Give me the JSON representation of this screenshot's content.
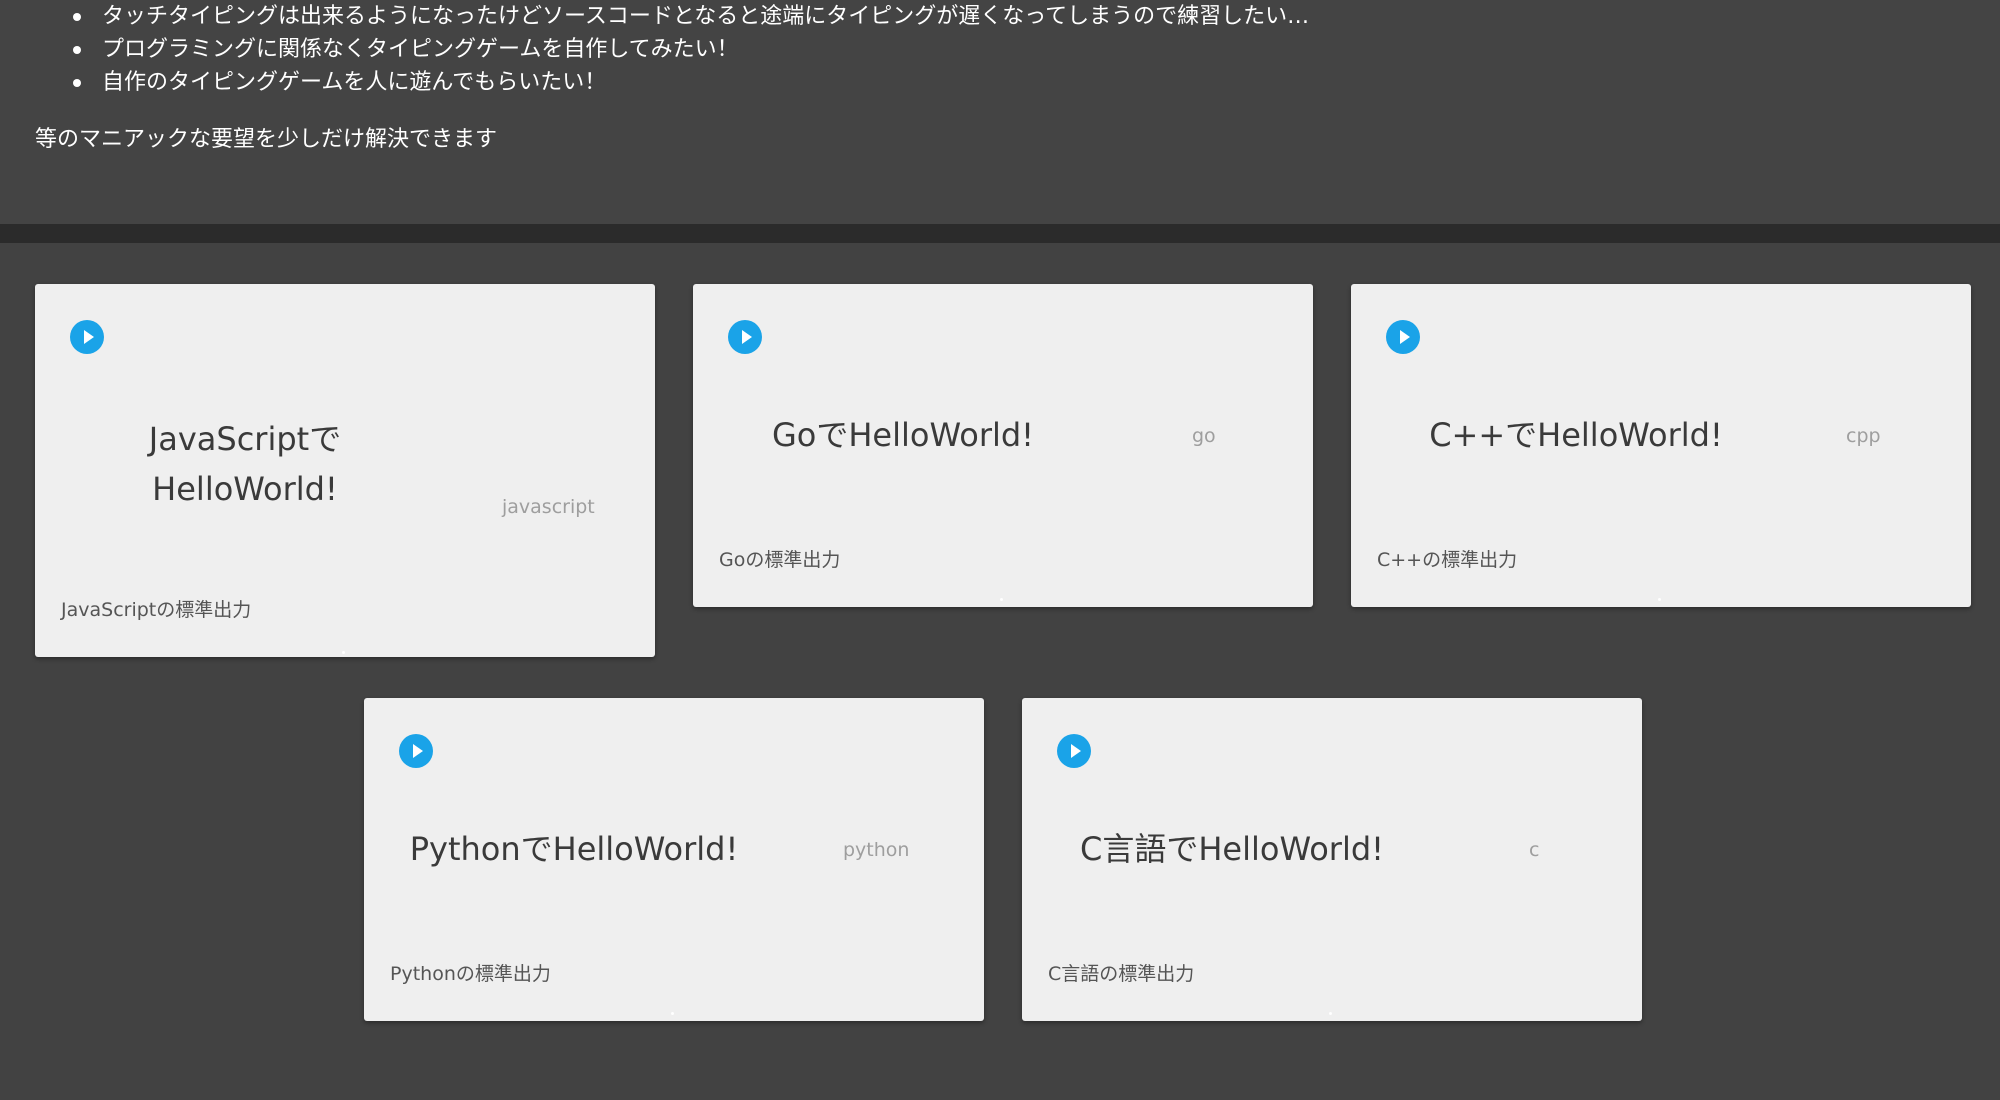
{
  "intro": {
    "bullets": [
      "タッチタイピングは出来るようになったけどソースコードとなると途端にタイピングが遅くなってしまうので練習したい…",
      "プログラミングに関係なくタイピングゲームを自作してみたい！",
      "自作のタイピングゲームを人に遊んでもらいたい！"
    ],
    "closing": "等のマニアックな要望を少しだけ解決できます"
  },
  "cards": [
    {
      "title_line1": "JavaScriptで",
      "title_line2": "HelloWorld!",
      "tag": "javascript",
      "description": "JavaScriptの標準出力",
      "icon": "play-circle-icon"
    },
    {
      "title": "GoでHelloWorld!",
      "tag": "go",
      "description": "Goの標準出力",
      "icon": "play-circle-icon"
    },
    {
      "title": "C++でHelloWorld!",
      "tag": "cpp",
      "description": "C++の標準出力",
      "icon": "play-circle-icon"
    },
    {
      "title": "PythonでHelloWorld!",
      "tag": "python",
      "description": "Pythonの標準出力",
      "icon": "play-circle-icon"
    },
    {
      "title": "C言語でHelloWorld!",
      "tag": "c",
      "description": "C言語の標準出力",
      "icon": "play-circle-icon"
    }
  ],
  "colors": {
    "page_background": "#424242",
    "divider": "#2b2b2b",
    "card_background": "#efefef",
    "play_button": "#1aa3e8",
    "title_text": "#3a3a3a",
    "tag_text": "#9e9e9e"
  }
}
